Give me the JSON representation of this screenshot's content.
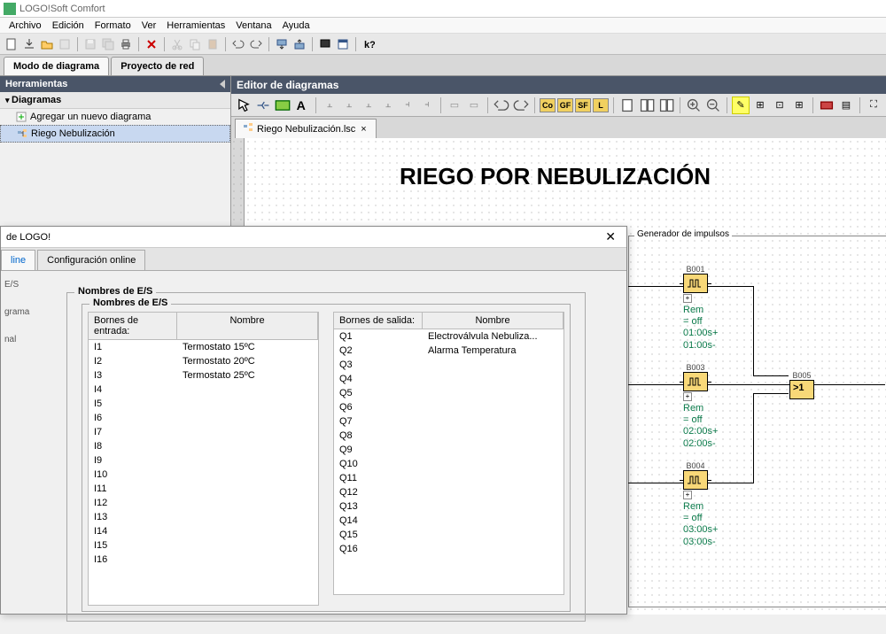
{
  "app": {
    "title": "LOGO!Soft Comfort"
  },
  "menu": [
    "Archivo",
    "Edición",
    "Formato",
    "Ver",
    "Herramientas",
    "Ventana",
    "Ayuda"
  ],
  "main_tabs": {
    "diagram_mode": "Modo de diagrama",
    "network_project": "Proyecto de red"
  },
  "sidebar": {
    "title": "Herramientas",
    "diagrams_label": "Diagramas",
    "add_new": "Agregar un nuevo diagrama",
    "current": "Riego Nebulización"
  },
  "editor": {
    "title": "Editor de diagramas",
    "file_tab": "Riego Nebulización.lsc",
    "canvas_title": "RIEGO POR NEBULIZACIÓN",
    "const_buttons": [
      "Co",
      "GF",
      "SF",
      "L"
    ],
    "group_label": "Generador de impulsos",
    "blocks": [
      {
        "id": "B001",
        "rem": "Rem = off",
        "p1": "01:00s+",
        "p2": "01:00s-"
      },
      {
        "id": "B003",
        "rem": "Rem = off",
        "p1": "02:00s+",
        "p2": "02:00s-"
      },
      {
        "id": "B004",
        "rem": "Rem = off",
        "p1": "03:00s+",
        "p2": "03:00s-"
      }
    ],
    "or_block": {
      "id": "B005",
      "symbol": ">1"
    }
  },
  "dialog": {
    "title": "de LOGO!",
    "tabs": {
      "offline": "line",
      "online": "Configuración online"
    },
    "left_items": [
      "E/S",
      "grama",
      "nal"
    ],
    "outer_legend": "Nombres de E/S",
    "inner_legend": "Nombres de E/S",
    "input_head": {
      "c1": "Bornes de entrada:",
      "c2": "Nombre"
    },
    "output_head": {
      "c1": "Bornes de salida:",
      "c2": "Nombre"
    },
    "inputs": [
      {
        "id": "I1",
        "name": "Termostato 15ºC"
      },
      {
        "id": "I2",
        "name": "Termostato 20ºC"
      },
      {
        "id": "I3",
        "name": "Termostato 25ºC"
      },
      {
        "id": "I4",
        "name": ""
      },
      {
        "id": "I5",
        "name": ""
      },
      {
        "id": "I6",
        "name": ""
      },
      {
        "id": "I7",
        "name": ""
      },
      {
        "id": "I8",
        "name": ""
      },
      {
        "id": "I9",
        "name": ""
      },
      {
        "id": "I10",
        "name": ""
      },
      {
        "id": "I11",
        "name": ""
      },
      {
        "id": "I12",
        "name": ""
      },
      {
        "id": "I13",
        "name": ""
      },
      {
        "id": "I14",
        "name": ""
      },
      {
        "id": "I15",
        "name": ""
      },
      {
        "id": "I16",
        "name": ""
      }
    ],
    "outputs": [
      {
        "id": "Q1",
        "name": "Electroválvula Nebuliza..."
      },
      {
        "id": "Q2",
        "name": "Alarma Temperatura"
      },
      {
        "id": "Q3",
        "name": ""
      },
      {
        "id": "Q4",
        "name": ""
      },
      {
        "id": "Q5",
        "name": ""
      },
      {
        "id": "Q6",
        "name": ""
      },
      {
        "id": "Q7",
        "name": ""
      },
      {
        "id": "Q8",
        "name": ""
      },
      {
        "id": "Q9",
        "name": ""
      },
      {
        "id": "Q10",
        "name": ""
      },
      {
        "id": "Q11",
        "name": ""
      },
      {
        "id": "Q12",
        "name": ""
      },
      {
        "id": "Q13",
        "name": ""
      },
      {
        "id": "Q14",
        "name": ""
      },
      {
        "id": "Q15",
        "name": ""
      },
      {
        "id": "Q16",
        "name": ""
      }
    ]
  }
}
